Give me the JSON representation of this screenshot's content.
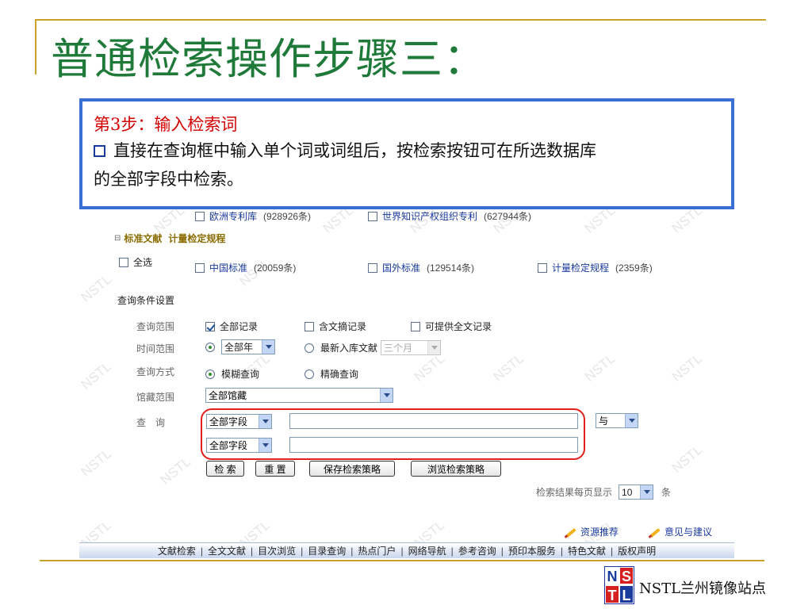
{
  "slide": {
    "title": "普通检索操作步骤三：",
    "site_label": "NSTL兰州镜像站点",
    "logo_letters": [
      "N",
      "S",
      "T",
      "L"
    ]
  },
  "note": {
    "step": "第3步：输入检索词",
    "line1": "直接在查询框中输入单个词或词组后，按检索按钮可在所选数据库",
    "line2": "的全部字段中检索。"
  },
  "watermark": "NSTL",
  "patents": [
    {
      "name": "欧洲专利库",
      "count": "(928926条)"
    },
    {
      "name": "世界知识产权组织专利",
      "count": "(627944条)"
    }
  ],
  "standards": {
    "tree_label": "标准文献",
    "tree_sub": "计量检定规程",
    "select_all": "全选",
    "items": [
      {
        "name": "中国标准",
        "count": "(20059条)"
      },
      {
        "name": "国外标准",
        "count": "(129514条)"
      },
      {
        "name": "计量检定规程",
        "count": "(2359条)"
      }
    ]
  },
  "conditions": {
    "heading": "查询条件设置",
    "scope_label": "查询范围",
    "scope_options": [
      "全部记录",
      "含文摘记录",
      "可提供全文记录"
    ],
    "time_label": "时间范围",
    "time_all_year": "全部年",
    "time_recent": "最新入库文献",
    "time_recent_value": "三个月",
    "method_label": "查询方式",
    "method_options": [
      "模糊查询",
      "精确查询"
    ],
    "holdings_label": "馆藏范围",
    "holdings_value": "全部馆藏",
    "query_label": "查　询",
    "field1": "全部字段",
    "field2": "全部字段",
    "query1_value": "",
    "query2_value": "",
    "logic_value": "与"
  },
  "buttons": {
    "search": "检 索",
    "reset": "重 置",
    "save_strategy": "保存检索策略",
    "browse_strategy": "浏览检索策略"
  },
  "per_page": {
    "label": "检索结果每页显示",
    "value": "10",
    "unit": "条"
  },
  "links": {
    "recommend": "资源推荐",
    "feedback": "意见与建议"
  },
  "footer": [
    "文献检索",
    "全文文献",
    "目次浏览",
    "目录查询",
    "热点门户",
    "网络导航",
    "参考咨询",
    "预印本服务",
    "特色文献",
    "版权声明"
  ],
  "colors": {
    "title_green": "#1f7a3a",
    "note_border": "#3a6fd6",
    "step_red": "#d40000",
    "highlight_red": "#e0201c",
    "frame_gold": "#c9a227"
  }
}
